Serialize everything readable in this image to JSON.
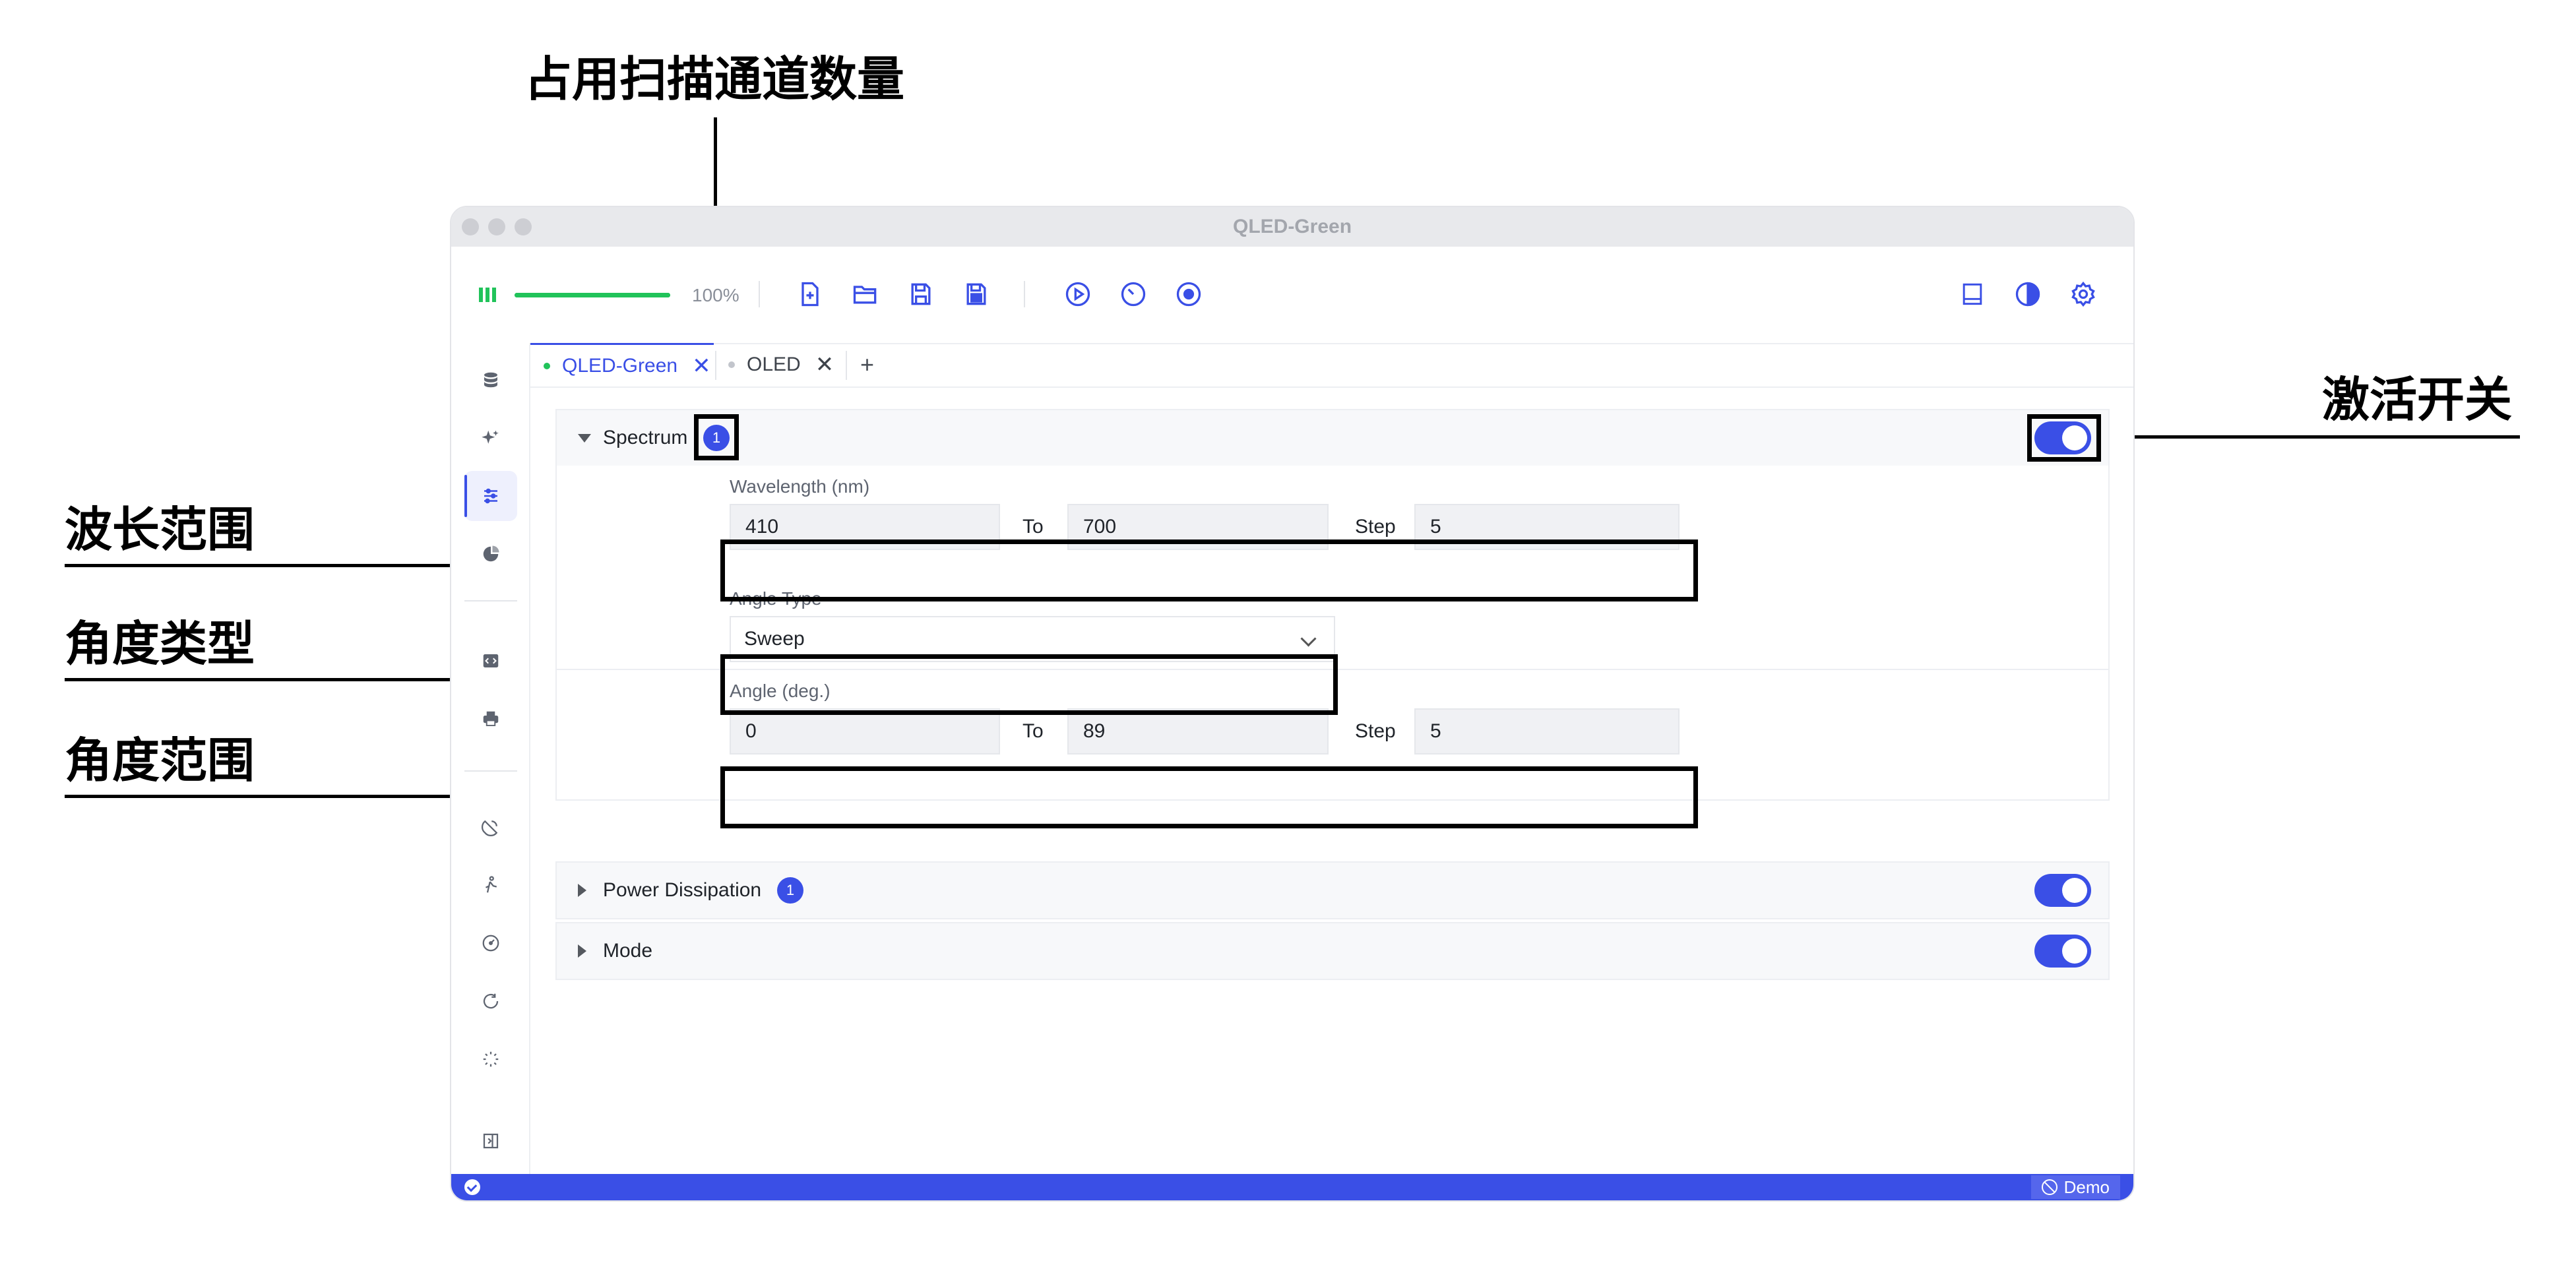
{
  "annotations": {
    "scan_channels": "占用扫描通道数量",
    "activate_switch": "激活开关",
    "wavelength_range": "波长范围",
    "angle_type": "角度类型",
    "angle_range": "角度范围"
  },
  "window": {
    "title": "QLED-Green"
  },
  "toolbar": {
    "progress_percent": 100,
    "progress_text": "100%",
    "file_icons": [
      "new-file-icon",
      "open-folder-icon",
      "save-icon",
      "save-as-icon"
    ],
    "run_icons": [
      "play-icon",
      "timer-icon",
      "stop-icon"
    ],
    "right_icons": [
      "panel-icon",
      "theme-icon",
      "gear-icon"
    ]
  },
  "tabs": [
    {
      "label": "QLED-Green",
      "active": true,
      "dot_color": "#21c35a"
    },
    {
      "label": "OLED",
      "active": false,
      "dot_color": "#c2c5cc"
    }
  ],
  "tab_add_label": "+",
  "tab_close_label": "✕",
  "sections": {
    "spectrum": {
      "label": "Spectrum",
      "badge": "1",
      "enabled": true,
      "wavelength": {
        "label": "Wavelength (nm)",
        "from": "410",
        "to_label": "To",
        "to": "700",
        "step_label": "Step",
        "step": "5"
      },
      "angle_type": {
        "label": "Angle Type",
        "value": "Sweep"
      },
      "angle": {
        "label": "Angle (deg.)",
        "from": "0",
        "to_label": "To",
        "to": "89",
        "step_label": "Step",
        "step": "5"
      }
    },
    "power": {
      "label": "Power Dissipation",
      "badge": "1",
      "enabled": true
    },
    "mode": {
      "label": "Mode",
      "enabled": true
    }
  },
  "statusbar": {
    "demo_label": "Demo"
  },
  "colors": {
    "accent": "#3a4fe6",
    "success": "#21c35a"
  }
}
